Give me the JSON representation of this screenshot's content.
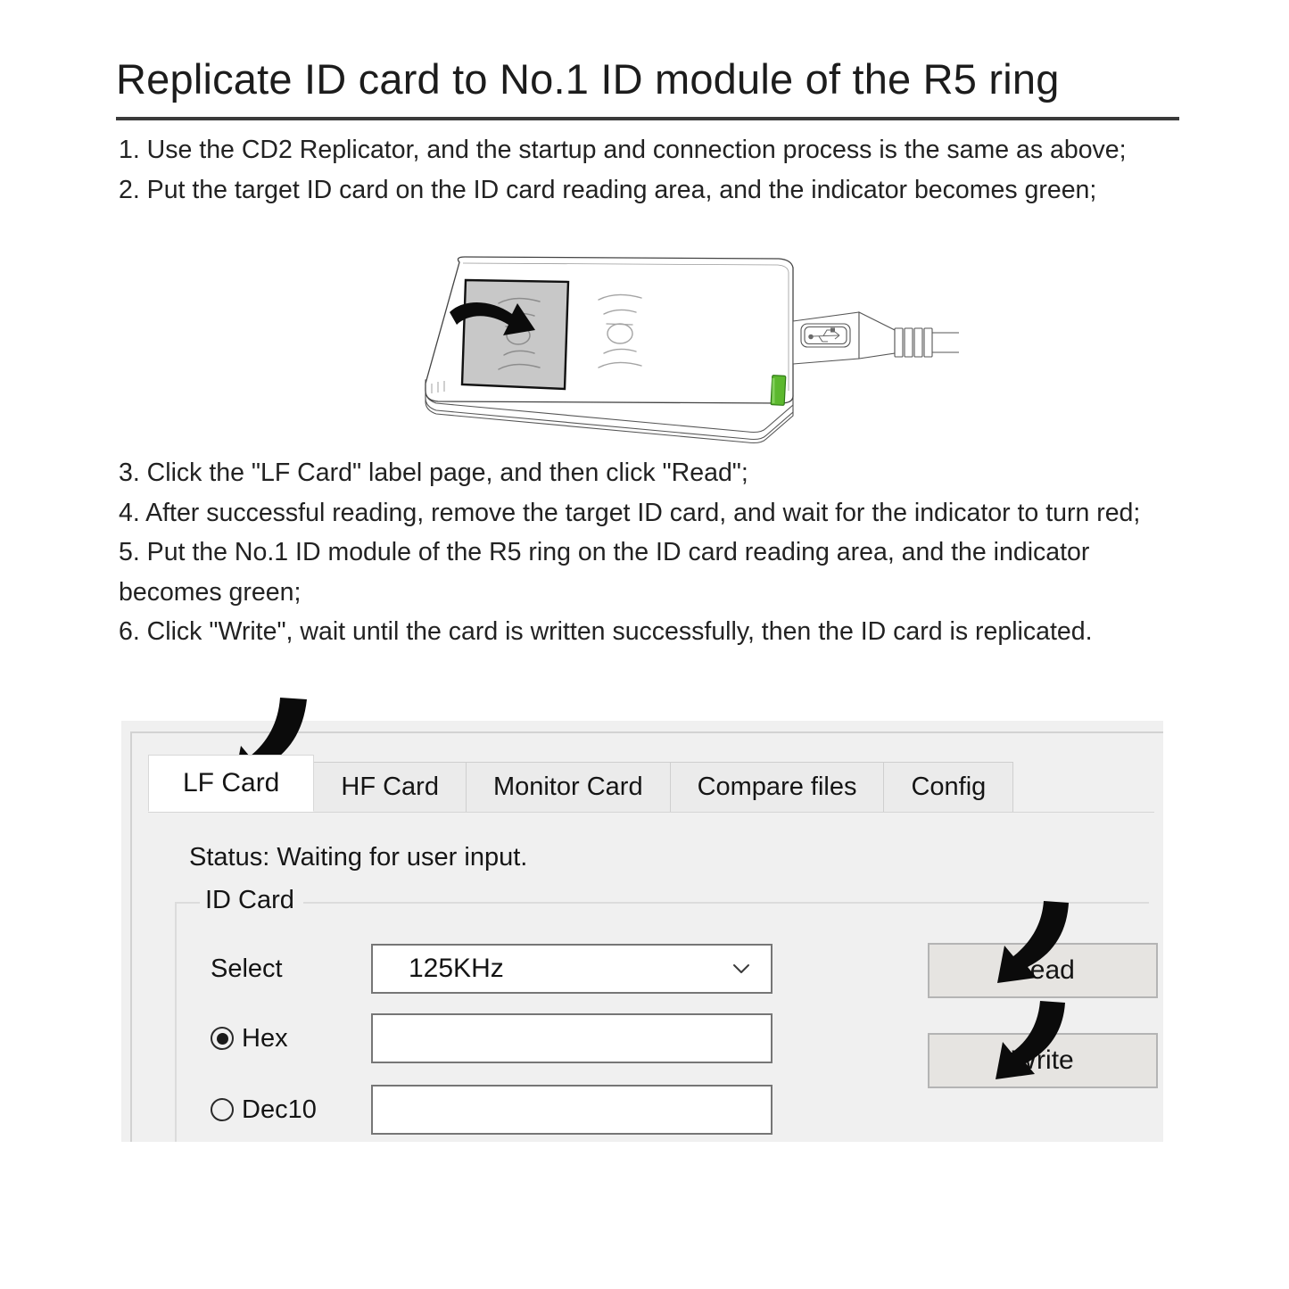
{
  "document": {
    "title": "Replicate ID card to No.1 ID module of the R5 ring",
    "steps": [
      "1. Use the CD2 Replicator, and the startup and connection process is the same as above;",
      "2. Put the target ID card on the ID card reading area, and the indicator becomes green;"
    ],
    "steps_lower": [
      "3. Click the \"LF Card\" label page, and then click \"Read\";",
      "4. After successful reading, remove the target ID card, and wait for the indicator to turn red;",
      "5. Put the No.1 ID module of the R5 ring on the ID card reading area, and the indicator becomes green;",
      "6. Click \"Write\", wait until the card is written successfully, then the ID card is replicated."
    ]
  },
  "illustration": {
    "name": "cd2-replicator-device",
    "card_area_label": "id-card-reading-area",
    "indicator_color": "#5cb82e",
    "card_color": "#c8c8c8",
    "body_color": "#ffffff",
    "outline_color": "#444444"
  },
  "app": {
    "tabs": [
      {
        "label": "LF Card",
        "active": true
      },
      {
        "label": "HF Card",
        "active": false
      },
      {
        "label": "Monitor Card",
        "active": false
      },
      {
        "label": "Compare files",
        "active": false
      },
      {
        "label": "Config",
        "active": false
      }
    ],
    "status": "Status: Waiting for user input.",
    "group": {
      "legend": "ID Card",
      "select_label": "Select",
      "select_value": "125KHz",
      "select_options": [
        "125KHz"
      ],
      "hex_label": "Hex",
      "hex_checked": true,
      "hex_value": "",
      "hex_placeholder": "",
      "dec_label": "Dec10",
      "dec_checked": false,
      "dec_value": "",
      "dec_placeholder": ""
    },
    "buttons": {
      "read": "Read",
      "write": "Write"
    },
    "colors": {
      "panel_bg": "#f0f0f0",
      "active_tab_bg": "#ffffff",
      "inactive_tab_bg": "#ebebeb",
      "button_bg": "#e6e4e1",
      "field_border": "#767676"
    }
  },
  "annotations": [
    {
      "name": "arrow-to-lf-card-tab",
      "target": "LF Card"
    },
    {
      "name": "arrow-to-read-button",
      "target": "Read"
    },
    {
      "name": "arrow-to-write-button",
      "target": "Write"
    },
    {
      "name": "arrow-to-card-reading-area",
      "target": "ID card reading area"
    }
  ]
}
